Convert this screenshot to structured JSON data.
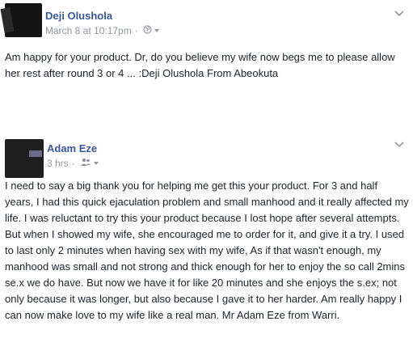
{
  "posts": [
    {
      "author": "Deji Olushola",
      "timestamp": "March 8 at 10:17pm",
      "separator": "·",
      "privacy_icon": "globe-icon",
      "menu_icon": "chevron-down-icon",
      "text": "Am happy for your product. Dr, do you believe my wife now begs me to please allow her rest after round 3 or 4 ... :Deji Olushola From Abeokuta"
    },
    {
      "author": "Adam Eze",
      "timestamp": "3 hrs",
      "separator": "·",
      "privacy_icon": "friends-icon",
      "menu_icon": "chevron-down-icon",
      "text": "I need to say a big thank you for helping me get this your product. For 3 and half years, I had this quick ejaculation problem and small manhood and it really affected my life. I was reluctant to try this your product because I lost hope after several attempts. But when I showed my wife, she encouraged me to order for it, and give it a try. I used to last only 2 minutes when having sex with my wife, As if that wasn't enough, my manhood was small and not strong and thick enough for her to enjoy the so call 2mins se.x we do have. But now we have it for like 20 minutes and she enjoys the s.ex; not only because it was longer, but also because I gave it to her harder. Am really happy I can now make love to my wife like a real man. Mr Adam Eze from Warri."
    }
  ],
  "colors": {
    "author": "#365899",
    "meta": "#90949c",
    "text": "#1d2129"
  }
}
